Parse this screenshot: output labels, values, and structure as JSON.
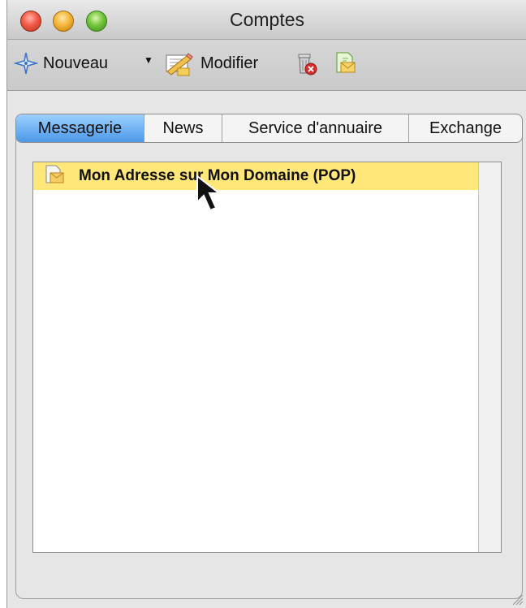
{
  "window": {
    "title": "Comptes"
  },
  "toolbar": {
    "new_label": "Nouveau",
    "edit_label": "Modifier"
  },
  "tabs": [
    {
      "label": "Messagerie",
      "selected": true
    },
    {
      "label": "News",
      "selected": false
    },
    {
      "label": "Service d'annuaire",
      "selected": false
    },
    {
      "label": "Exchange",
      "selected": false
    }
  ],
  "accounts": [
    {
      "name": "Mon Adresse sur Mon Domaine (POP)",
      "selected": true,
      "icon": "mail-account-icon"
    }
  ],
  "colors": {
    "selection_row": "#ffe77a",
    "active_tab": "#4c97e8"
  }
}
